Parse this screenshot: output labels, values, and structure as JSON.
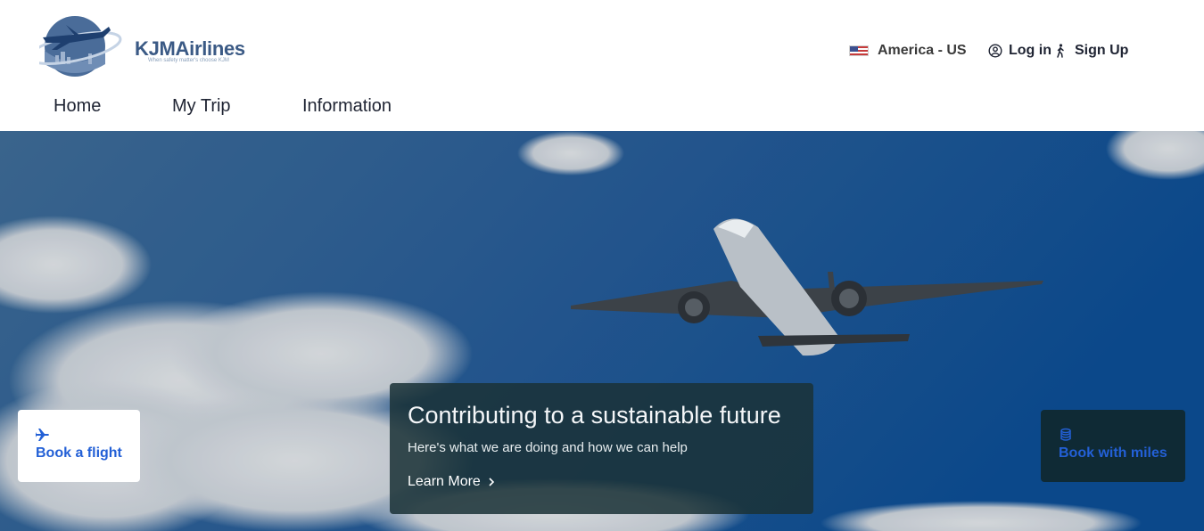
{
  "brand": {
    "name": "KJMAirlines",
    "tagline": "When safety matter's choose KJM"
  },
  "locale": {
    "label": "America - US",
    "flag_icon": "us-flag-icon"
  },
  "auth": {
    "login_label": "Log in",
    "login_icon": "user-circle-icon",
    "signup_label": "Sign Up",
    "signup_icon": "walking-person-icon"
  },
  "nav": {
    "items": [
      {
        "label": "Home"
      },
      {
        "label": "My Trip"
      },
      {
        "label": "Information"
      }
    ]
  },
  "hero": {
    "promo": {
      "title": "Contributing to a sustainable future",
      "subtitle": "Here's what we are doing and how we can help",
      "link_label": "Learn More",
      "link_icon": "chevron-right-icon"
    },
    "book_flight": {
      "label": "Book a flight",
      "icon": "airplane-icon"
    },
    "book_miles": {
      "label": "Book with miles",
      "icon": "database-icon"
    }
  },
  "colors": {
    "brand": "#3b5a85",
    "link_blue": "#2360d6",
    "promo_bg": "#1b3237",
    "miles_card_bg": "#0f2a35"
  }
}
